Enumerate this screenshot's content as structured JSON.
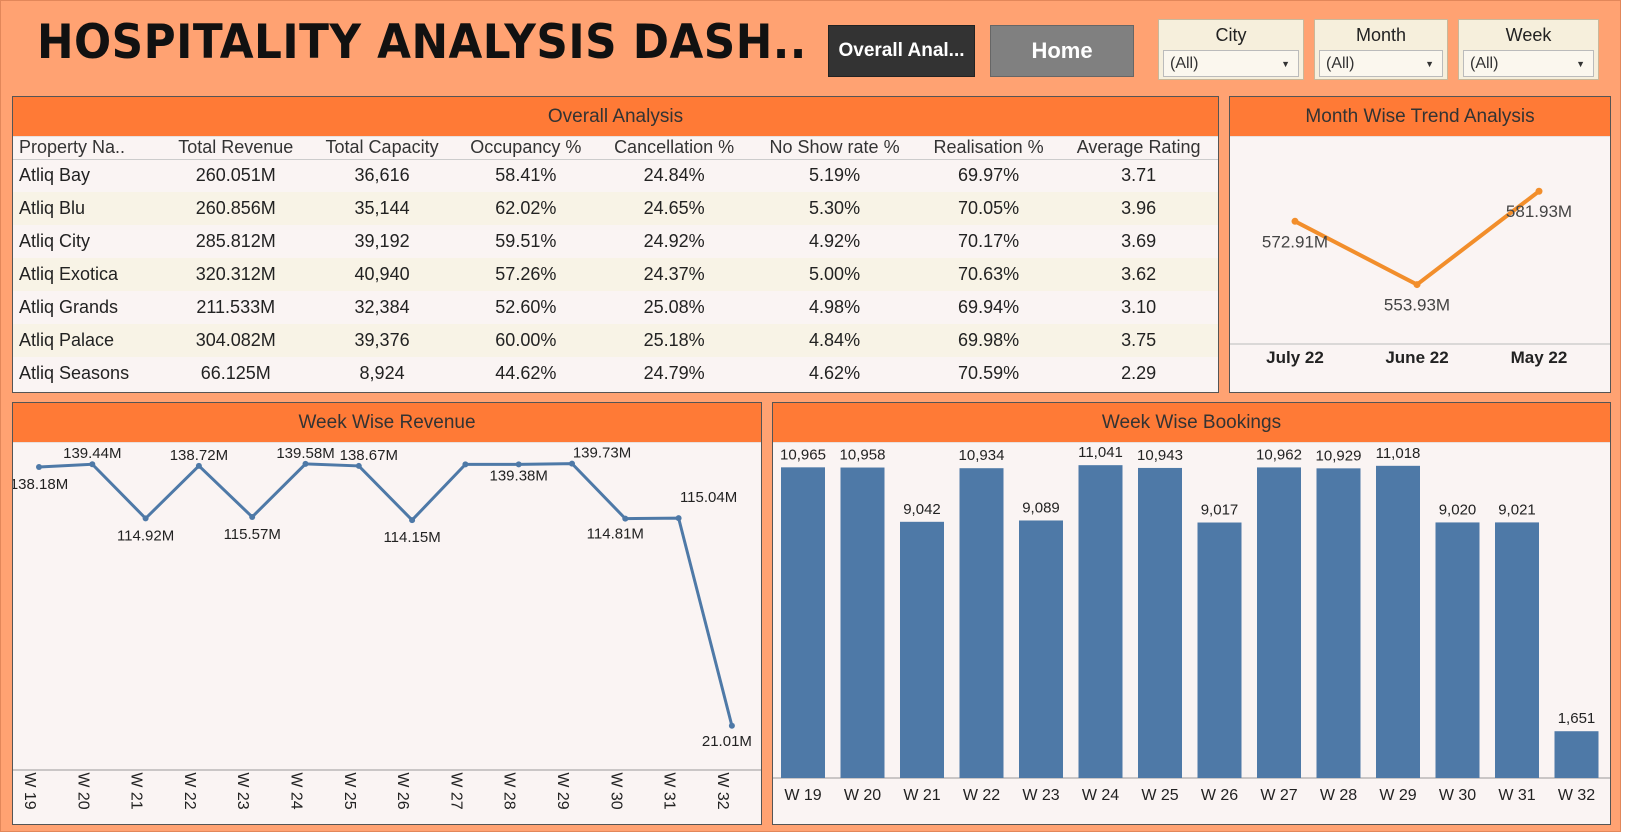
{
  "header": {
    "title": "HOSPITALITY ANALYSIS DASH..",
    "overall_button": "Overall Anal...",
    "home_button": "Home"
  },
  "filters": [
    {
      "label": "City",
      "value": "(All)"
    },
    {
      "label": "Month",
      "value": "(All)"
    },
    {
      "label": "Week",
      "value": "(All)"
    }
  ],
  "overall": {
    "title": "Overall Analysis",
    "columns": [
      "Property Na..",
      "Total Revenue",
      "Total Capacity",
      "Occupancy %",
      "Cancellation %",
      "No Show rate %",
      "Realisation %",
      "Average Rating"
    ],
    "rows": [
      [
        "Atliq Bay",
        "260.051M",
        "36,616",
        "58.41%",
        "24.84%",
        "5.19%",
        "69.97%",
        "3.71"
      ],
      [
        "Atliq Blu",
        "260.856M",
        "35,144",
        "62.02%",
        "24.65%",
        "5.30%",
        "70.05%",
        "3.96"
      ],
      [
        "Atliq City",
        "285.812M",
        "39,192",
        "59.51%",
        "24.92%",
        "4.92%",
        "70.17%",
        "3.69"
      ],
      [
        "Atliq Exotica",
        "320.312M",
        "40,940",
        "57.26%",
        "24.37%",
        "5.00%",
        "70.63%",
        "3.62"
      ],
      [
        "Atliq Grands",
        "211.533M",
        "32,384",
        "52.60%",
        "25.08%",
        "4.98%",
        "69.94%",
        "3.10"
      ],
      [
        "Atliq Palace",
        "304.082M",
        "39,376",
        "60.00%",
        "25.18%",
        "4.84%",
        "69.98%",
        "3.75"
      ],
      [
        "Atliq Seasons",
        "66.125M",
        "8,924",
        "44.62%",
        "24.79%",
        "4.62%",
        "70.59%",
        "2.29"
      ]
    ]
  },
  "colors": {
    "background": "#ffa272",
    "panel_header": "#ff7a36",
    "month_line": "#f28e2b",
    "week_line": "#4e79a7",
    "bar": "#4e79a7"
  },
  "chart_data": [
    {
      "type": "line",
      "title": "Month Wise Trend Analysis",
      "categories": [
        "July 22",
        "June 22",
        "May 22"
      ],
      "values": [
        572.91,
        553.93,
        581.93
      ],
      "labels": [
        "572.91M",
        "553.93M",
        "581.93M"
      ]
    },
    {
      "type": "line",
      "title": "Week Wise Revenue",
      "categories": [
        "W 19",
        "W 20",
        "W 21",
        "W 22",
        "W 23",
        "W 24",
        "W 25",
        "W 26",
        "W 27",
        "W 28",
        "W 29",
        "W 30",
        "W 31",
        "W 32"
      ],
      "values": [
        138.18,
        139.44,
        114.92,
        138.72,
        115.57,
        139.58,
        138.67,
        114.15,
        139.4,
        139.38,
        139.73,
        114.81,
        115.04,
        21.01
      ],
      "labels": [
        "138.18M",
        "139.44M",
        "114.92M",
        "138.72M",
        "115.57M",
        "139.58M",
        "138.67M",
        "114.15M",
        "",
        "139.38M",
        "139.73M",
        "114.81M",
        "115.04M",
        "21.01M"
      ]
    },
    {
      "type": "bar",
      "title": "Week Wise Bookings",
      "categories": [
        "W 19",
        "W 20",
        "W 21",
        "W 22",
        "W 23",
        "W 24",
        "W 25",
        "W 26",
        "W 27",
        "W 28",
        "W 29",
        "W 30",
        "W 31",
        "W 32"
      ],
      "values": [
        10965,
        10958,
        9042,
        10934,
        9089,
        11041,
        10943,
        9017,
        10962,
        10929,
        11018,
        9020,
        9021,
        1651
      ],
      "labels": [
        "10,965",
        "10,958",
        "9,042",
        "10,934",
        "9,089",
        "11,041",
        "10,943",
        "9,017",
        "10,962",
        "10,929",
        "11,018",
        "9,020",
        "9,021",
        "1,651"
      ]
    }
  ]
}
